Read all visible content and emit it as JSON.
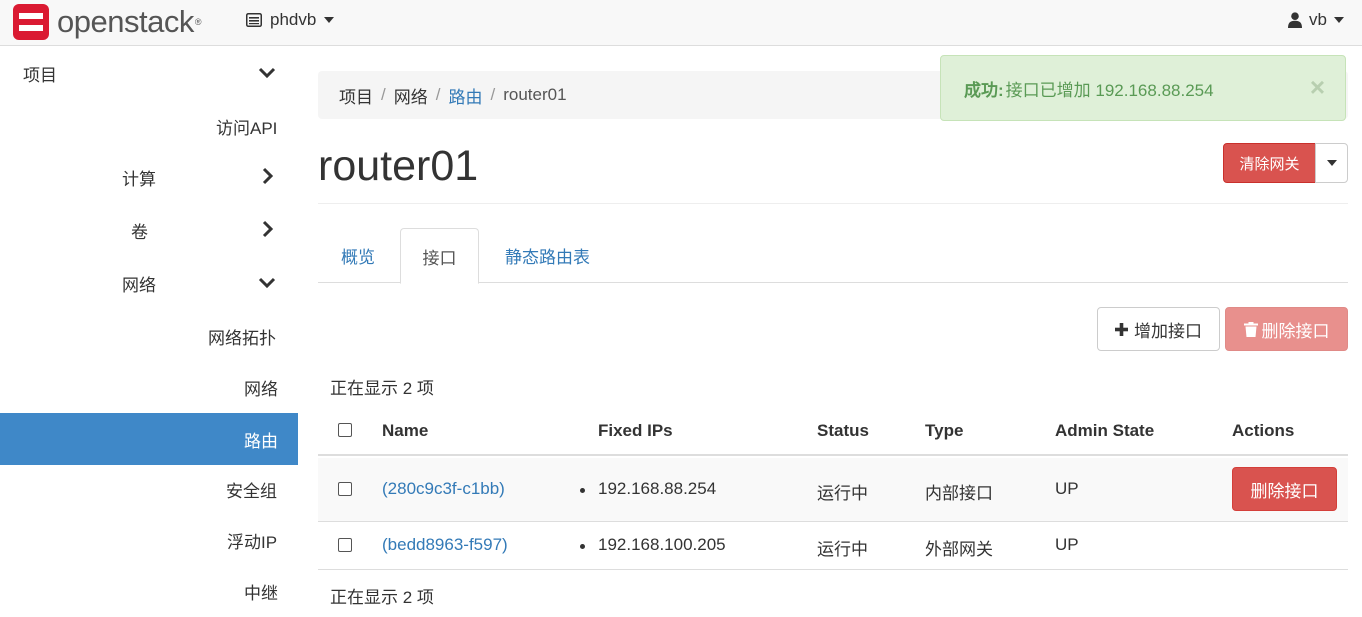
{
  "navbar": {
    "brand": "openstack",
    "brand_mark": "®",
    "project": "phdvb",
    "user": "vb"
  },
  "sidebar": {
    "items": [
      {
        "label": "项目",
        "icon": "chevron-down-icon"
      },
      {
        "label": "访问API"
      },
      {
        "label": "计算",
        "icon": "chevron-right-icon"
      },
      {
        "label": "卷",
        "icon": "chevron-right-icon"
      },
      {
        "label": "网络",
        "icon": "chevron-down-icon"
      },
      {
        "label": "网络拓扑"
      },
      {
        "label": "网络"
      },
      {
        "label": "路由",
        "active": true
      },
      {
        "label": "安全组"
      },
      {
        "label": "浮动IP"
      },
      {
        "label": "中继"
      }
    ]
  },
  "breadcrumb": {
    "items": [
      "项目",
      "网络",
      "路由",
      "router01"
    ]
  },
  "alert": {
    "strong": "成功:",
    "message": "接口已增加 192.168.88.254",
    "close": "×"
  },
  "page": {
    "title": "router01",
    "clear_gateway": "清除网关"
  },
  "tabs": [
    "概览",
    "接口",
    "静态路由表"
  ],
  "actions": {
    "add_interface": "增加接口",
    "delete_interfaces": "删除接口"
  },
  "table": {
    "count_top": "正在显示 2 项",
    "count_bottom": "正在显示 2 项",
    "columns": [
      "Name",
      "Fixed IPs",
      "Status",
      "Type",
      "Admin State",
      "Actions"
    ],
    "rows": [
      {
        "name": "(280c9c3f-c1bb)",
        "fixed_ip": "192.168.88.254",
        "status": "运行中",
        "type": "内部接口",
        "admin_state": "UP",
        "action": "删除接口"
      },
      {
        "name": "(bedd8963-f597)",
        "fixed_ip": "192.168.100.205",
        "status": "运行中",
        "type": "外部网关",
        "admin_state": "UP",
        "action": ""
      }
    ]
  },
  "colors": {
    "primary": "#337ab7",
    "danger": "#d9534f",
    "active_nav": "#3f88c8",
    "success_bg": "#dff0d8",
    "logo_red": "#da1a32"
  }
}
